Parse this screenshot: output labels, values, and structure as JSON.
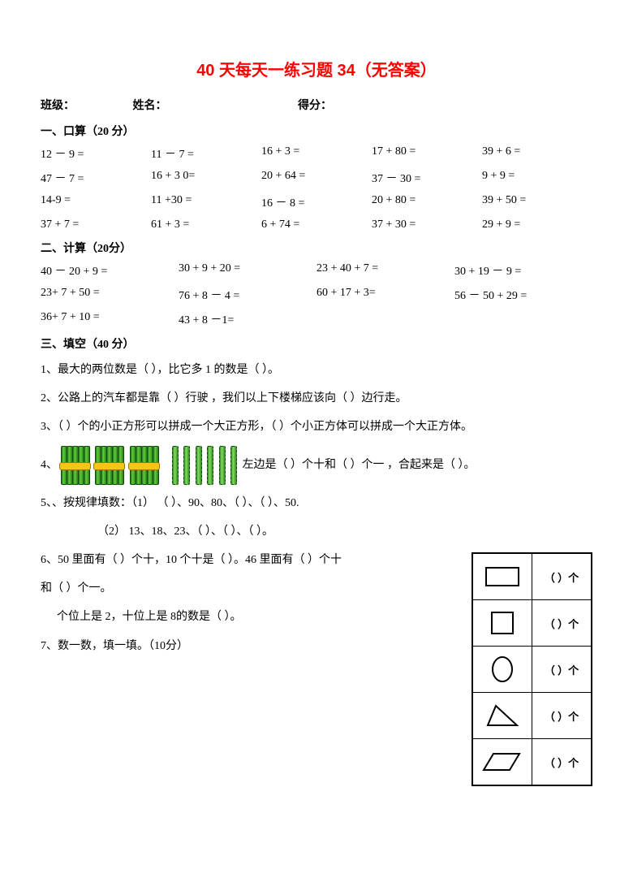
{
  "title": "40 天每天一练习题 34（无答案）",
  "header": {
    "class_label": "班级：",
    "name_label": "姓名：",
    "score_label": "得分："
  },
  "sections": {
    "s1_title": "一、口算（20 分）",
    "s1_rows": [
      [
        "12 － 9 =",
        "11 － 7 =",
        "16 + 3 =",
        "17 + 80 =",
        "39 + 6 ="
      ],
      [
        "47 － 7 =",
        "16 + 3 0=",
        "20 + 64 =",
        "37 － 30 =",
        "9 + 9 ="
      ],
      [
        "14-9 =",
        "11 +30 =",
        "16 － 8 =",
        "20 + 80 =",
        "39 + 50 ="
      ],
      [
        "37 + 7 =",
        "61 + 3 =",
        "6 + 74 =",
        "37 + 30 =",
        "29 + 9 ="
      ]
    ],
    "s2_title": "二、计算（20分）",
    "s2_rows": [
      [
        "40 － 20 + 9 =",
        "30 + 9 + 20 =",
        "23 + 40 + 7 =",
        "30 + 19 － 9 ="
      ],
      [
        "23+ 7 + 50 =",
        "76 + 8 － 4 =",
        "60 + 17 + 3=",
        "56 － 50 + 29 ="
      ],
      [
        "36+ 7 + 10 =",
        "43 + 8 －1=",
        "",
        ""
      ]
    ],
    "s3_title": "三、填空（40 分）",
    "q1": "1、最大的两位数是（    ），比它多 1 的数是（    ）。",
    "q2": "2、公路上的汽车都是靠（    ）行驶 ，我们以上下楼梯应该向（    ）边行走。",
    "q3": "3、（    ）个的小正方形可以拼成一个大正方形，（    ）个小正方体可以拼成一个大正方体。",
    "q4_prefix": "4、",
    "q4_suffix": " 左边是（    ）个十和（    ）个一 ，合起来是（    ）。",
    "q5a": "5、、按规律填数：（1）   （   ）、90、80、（   ）、（   ）、50.",
    "q5b": "（2）   13、18、23、（   ）、（   ）、（   ）。",
    "q6a": "6、50 里面有（    ）个十，10 个十是（    ）。46 里面有（    ）个十",
    "q6b": "和（    ）个一。",
    "q6c": "个位上是 2，十位上是 8的数是（    ）。",
    "q7": "7、数一数，填一填。（10分）"
  },
  "shape_table": {
    "count_template": "（    ）个",
    "shapes": [
      "rectangle",
      "square",
      "circle",
      "triangle",
      "parallelogram"
    ]
  }
}
